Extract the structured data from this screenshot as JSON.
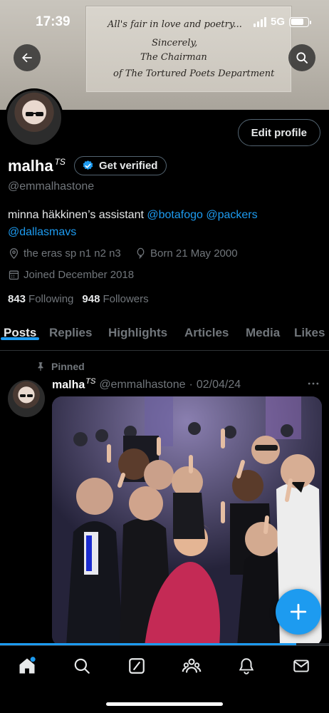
{
  "status_bar": {
    "time": "17:39",
    "network": "5G"
  },
  "banner": {
    "note_lines": [
      "All's fair in love and poetry...",
      "Sincerely,",
      "The Chairman",
      "of The Tortured Poets Department"
    ]
  },
  "profile": {
    "display_name": "malha",
    "name_suffix": "TS",
    "handle": "@emmalhastone",
    "edit_label": "Edit profile",
    "verify_label": "Get verified",
    "bio_text": "minna häkkinen’s assistant ",
    "bio_mentions": [
      "@botafogo",
      "@packers",
      "@dallasmavs"
    ],
    "location": "the eras sp n1 n2 n3",
    "birthday": "Born 21 May 2000",
    "joined": "Joined December 2018",
    "following_count": "843",
    "following_label": "Following",
    "followers_count": "948",
    "followers_label": "Followers"
  },
  "tabs": [
    {
      "label": "Posts",
      "active": true
    },
    {
      "label": "Replies"
    },
    {
      "label": "Highlights"
    },
    {
      "label": "Articles"
    },
    {
      "label": "Media"
    },
    {
      "label": "Likes"
    }
  ],
  "post": {
    "pinned_label": "Pinned",
    "author": "malha",
    "author_suffix": "TS",
    "handle": "@emmalhastone",
    "separator": "·",
    "date": "02/04/24"
  },
  "scroll_progress": 0.9,
  "colors": {
    "accent": "#1d9bf0",
    "background": "#000000",
    "muted": "#71767b"
  },
  "icons": [
    "back-arrow-icon",
    "search-icon",
    "verified-badge-icon",
    "location-pin-icon",
    "balloon-icon",
    "calendar-icon",
    "pin-icon",
    "more-icon",
    "plus-icon",
    "home-icon",
    "nav-search-icon",
    "grok-icon",
    "communities-icon",
    "notifications-icon",
    "messages-icon"
  ]
}
